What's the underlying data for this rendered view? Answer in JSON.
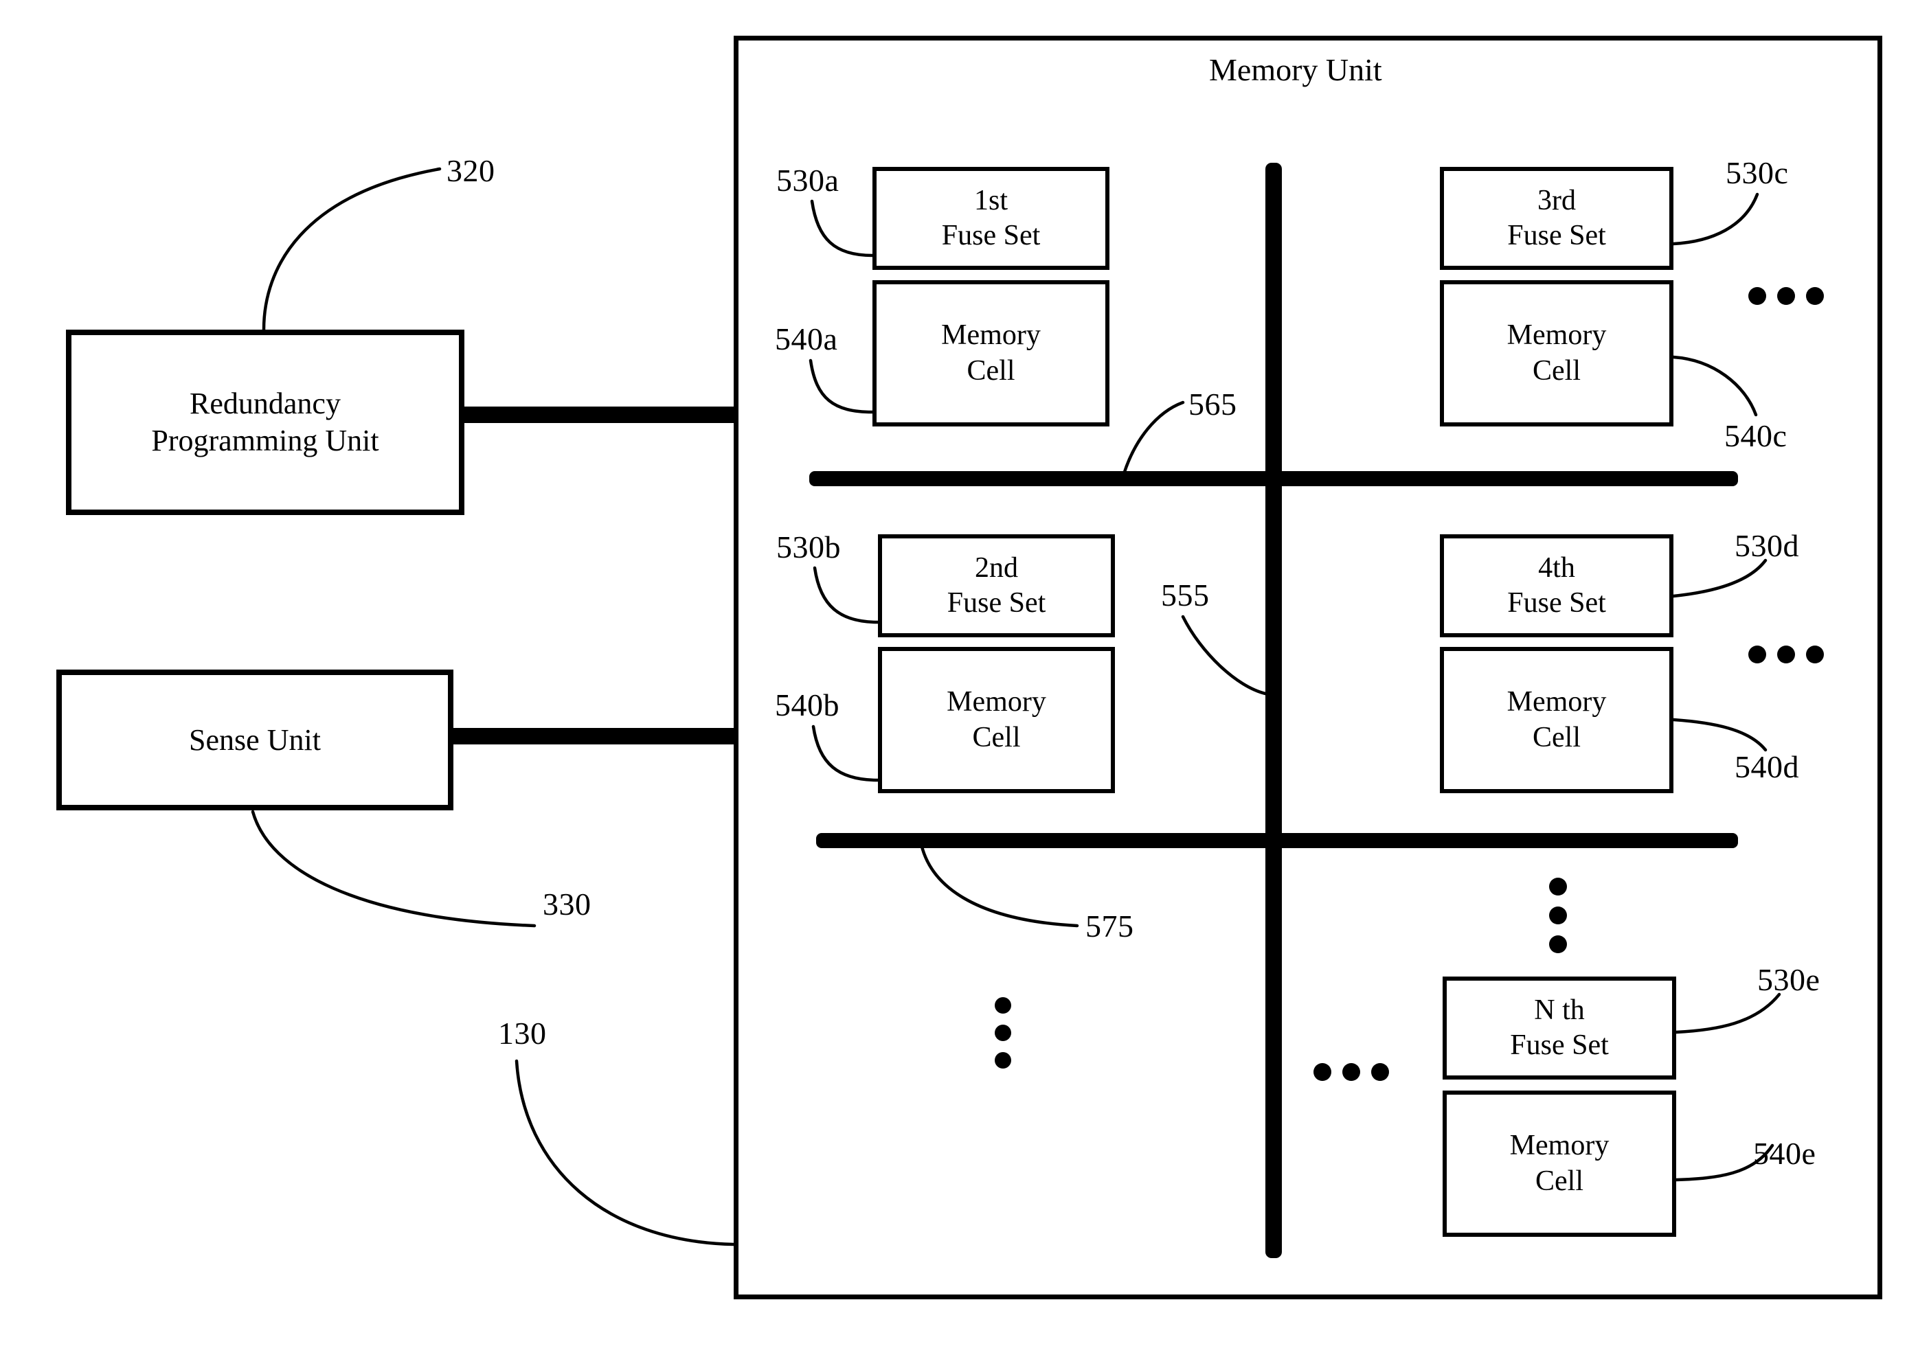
{
  "figure": {
    "memory_unit": {
      "title": "Memory Unit",
      "ref": "130"
    },
    "left_units": [
      {
        "label": "Redundancy\nProgramming Unit",
        "ref": "320"
      },
      {
        "label": "Sense Unit",
        "ref": "330"
      }
    ],
    "quadrants": [
      {
        "position": "top-left",
        "fuse_set": {
          "label": "1st\nFuse Set",
          "ref": "530a"
        },
        "memory_cell": {
          "label": "Memory\nCell",
          "ref": "540a"
        }
      },
      {
        "position": "top-right",
        "fuse_set": {
          "label": "3rd\nFuse Set",
          "ref": "530c"
        },
        "memory_cell": {
          "label": "Memory\nCell",
          "ref": "540c"
        }
      },
      {
        "position": "middle-left",
        "fuse_set": {
          "label": "2nd\nFuse Set",
          "ref": "530b"
        },
        "memory_cell": {
          "label": "Memory\nCell",
          "ref": "540b"
        }
      },
      {
        "position": "middle-right",
        "fuse_set": {
          "label": "4th\nFuse Set",
          "ref": "530d"
        },
        "memory_cell": {
          "label": "Memory\nCell",
          "ref": "540d"
        }
      },
      {
        "position": "bottom-right",
        "fuse_set": {
          "label": "N th\nFuse Set",
          "ref": "530e"
        },
        "memory_cell": {
          "label": "Memory\nCell",
          "ref": "540e"
        }
      }
    ],
    "dividers": [
      {
        "name": "upper-horizontal-divider",
        "ref": "565"
      },
      {
        "name": "vertical-divider",
        "ref": "555"
      },
      {
        "name": "lower-horizontal-divider",
        "ref": "575"
      }
    ],
    "colors": {
      "ink": "#000000",
      "background": "#ffffff"
    }
  }
}
